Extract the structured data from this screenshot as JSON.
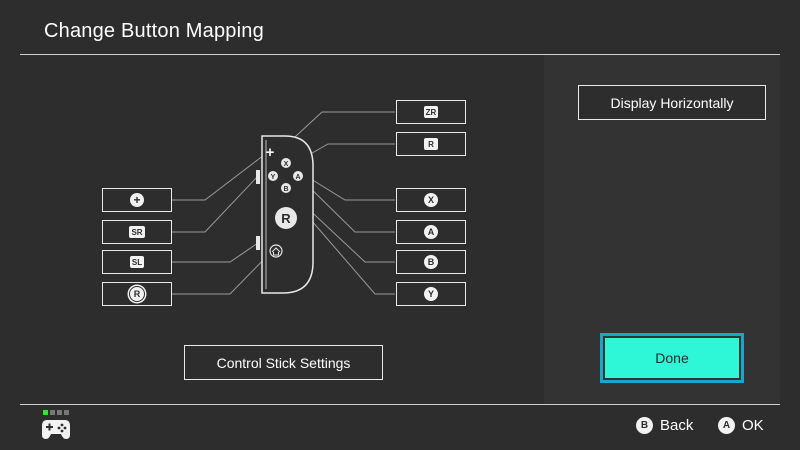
{
  "header": {
    "title": "Change Button Mapping"
  },
  "left_mappings": [
    {
      "glyph": "+",
      "shape": "round",
      "icon": "plus-icon"
    },
    {
      "glyph": "SR",
      "shape": "rect",
      "icon": "sr-icon"
    },
    {
      "glyph": "SL",
      "shape": "rect",
      "icon": "sl-icon"
    },
    {
      "glyph": "R",
      "shape": "stick",
      "icon": "stick-press-icon"
    }
  ],
  "right_mappings": [
    {
      "glyph": "ZR",
      "shape": "rect",
      "icon": "zr-icon"
    },
    {
      "glyph": "R",
      "shape": "rect",
      "icon": "r-icon"
    },
    {
      "glyph": "X",
      "shape": "round",
      "icon": "x-icon"
    },
    {
      "glyph": "A",
      "shape": "round",
      "icon": "a-icon"
    },
    {
      "glyph": "B",
      "shape": "round",
      "icon": "b-icon"
    },
    {
      "glyph": "Y",
      "shape": "round",
      "icon": "y-icon"
    }
  ],
  "controller": {
    "plus": "+",
    "face": {
      "x": "X",
      "y": "Y",
      "a": "A",
      "b": "B"
    },
    "stick": "R"
  },
  "buttons": {
    "control_stick": "Control Stick Settings",
    "display_horizontally": "Display Horizontally",
    "done": "Done"
  },
  "footer": {
    "back": {
      "glyph": "B",
      "label": "Back"
    },
    "ok": {
      "glyph": "A",
      "label": "OK"
    }
  },
  "colors": {
    "background": "#2d2d2d",
    "done_fill": "#2ef7d8",
    "focus_border": "#1aa6c8"
  }
}
